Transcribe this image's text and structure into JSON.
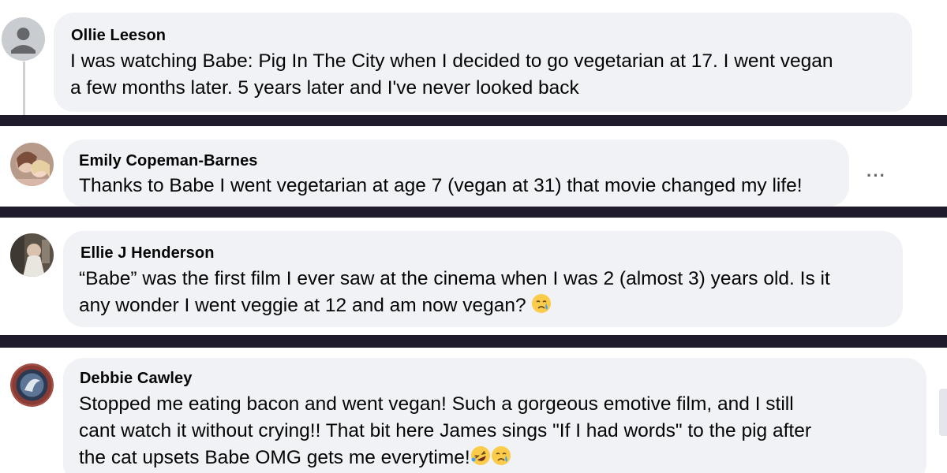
{
  "comments": [
    {
      "author": "Ollie Leeson",
      "lines": [
        "I was watching Babe: Pig In The City when I decided to go vegetarian at 17. I went vegan",
        "a few months later. 5 years later and I've never looked back"
      ],
      "avatar": "default-profile-avatar"
    },
    {
      "author": "Emily Copeman-Barnes",
      "lines": [
        "Thanks to Babe I went vegetarian at age 7 (vegan at 31) that movie changed my life!"
      ],
      "avatar": "user-photo-avatar",
      "more_icon": "ellipsis-icon",
      "more_label": "···"
    },
    {
      "author": "Ellie J Henderson",
      "lines": [
        "“Babe” was the first film I ever saw at the cinema when I was 2 (almost 3) years old. Is it",
        "any wonder I went veggie at 12 and am now vegan?"
      ],
      "avatar": "user-photo-avatar",
      "emojis": [
        "crying-face-emoji"
      ]
    },
    {
      "author": "Debbie Cawley",
      "lines": [
        "Stopped me eating bacon and went vegan! Such a gorgeous emotive film, and I still",
        "cant watch it without crying!! That bit here James sings \"If I had words\" to the pig after",
        "the cat upsets Babe OMG gets me everytime!"
      ],
      "avatar": "user-photo-avatar",
      "emojis": [
        "rolling-laughing-emoji",
        "crying-face-emoji"
      ]
    }
  ],
  "colors": {
    "bubble": "#f0f2f5",
    "separator": "#1f1a2c",
    "text": "#050505"
  }
}
